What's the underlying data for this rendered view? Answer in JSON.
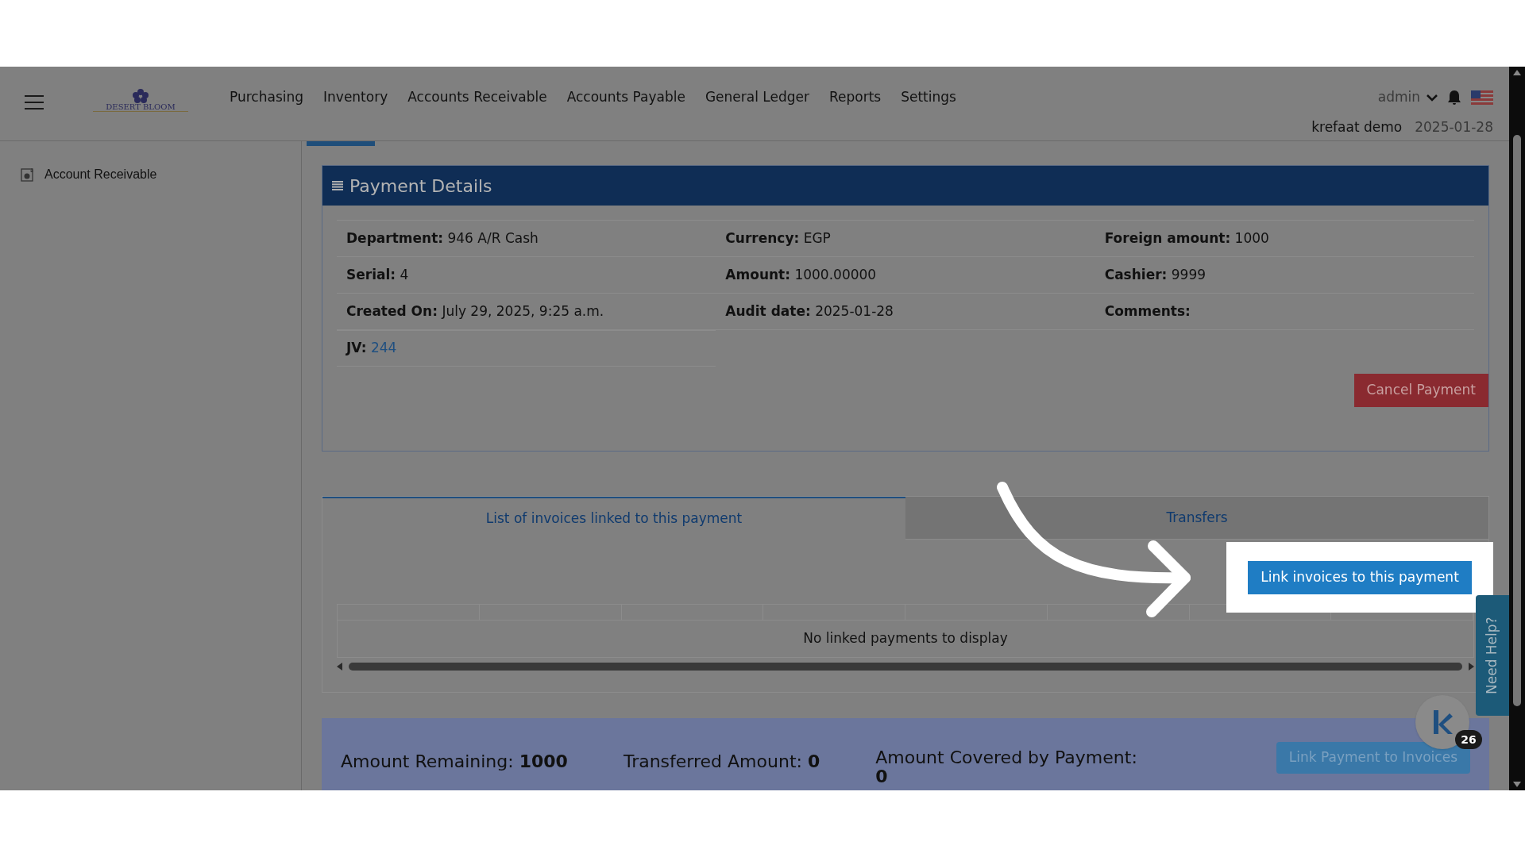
{
  "nav": {
    "logo": "DESERT BLOOM",
    "menu_items": [
      "Purchasing",
      "Inventory",
      "Accounts Receivable",
      "Accounts Payable",
      "General Ledger",
      "Reports",
      "Settings"
    ],
    "user": "admin",
    "company": "krefaat demo",
    "date": "2025-01-28"
  },
  "sidebar": {
    "items": [
      {
        "label": "Account Receivable"
      }
    ]
  },
  "payment_details": {
    "title": "Payment Details",
    "fields": [
      {
        "label": "Department:",
        "value": "946 A/R Cash"
      },
      {
        "label": "Currency:",
        "value": "EGP"
      },
      {
        "label": "Foreign amount:",
        "value": "1000"
      },
      {
        "label": "Serial:",
        "value": "4"
      },
      {
        "label": "Amount:",
        "value": "1000.00000"
      },
      {
        "label": "Cashier:",
        "value": "9999"
      },
      {
        "label": "Created On:",
        "value": "July 29, 2025, 9:25 a.m."
      },
      {
        "label": "Audit date:",
        "value": "2025-01-28"
      },
      {
        "label": "Comments:"
      },
      {
        "label": "JV:",
        "value": "244",
        "kind": "link"
      }
    ],
    "cancel_button": "Cancel Payment"
  },
  "tabs": [
    {
      "label": "List of invoices linked to this payment",
      "selected": true
    },
    {
      "label": "Transfers",
      "selected": false
    }
  ],
  "link_button": "Link invoices to this payment",
  "table": {
    "empty_message": "No linked payments to display"
  },
  "summary": {
    "items": [
      {
        "label": "Amount Remaining:",
        "value": "1000"
      },
      {
        "label": "Transferred Amount:",
        "value": "0"
      },
      {
        "label": "Amount Covered by Payment:",
        "value": "0"
      }
    ],
    "button": "Link Payment to Invoices"
  },
  "help_tab": "Need Help?",
  "chat_badge": "26"
}
